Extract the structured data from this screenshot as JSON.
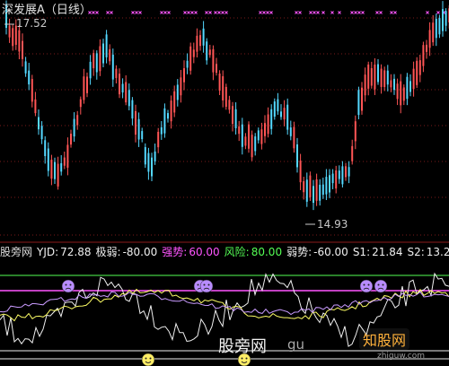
{
  "title": "深发展A（日线）",
  "price": {
    "high": "17.52",
    "low": "14.93"
  },
  "indicator": {
    "name": "股旁网",
    "yjd_label": "YJD:",
    "yjd_value": "72.88",
    "jiruo_label": "极弱:",
    "jiruo_value": "-80.00",
    "qiangshi_label": "强势:",
    "qiangshi_value": "60.00",
    "fengxian_label": "风险:",
    "fengxian_value": "80.00",
    "ruoshi_label": "弱势:",
    "ruoshi_value": "-60.00",
    "s1_label": "S1:",
    "s1_value": "21.84",
    "s2_label": "S2:",
    "s2_value": "13.20"
  },
  "colors": {
    "up": "#ff5555",
    "down": "#54d8ff",
    "grid": "#7a1a1a",
    "magenta": "#ff55ff",
    "green": "#55ff55",
    "white": "#f0f0f0",
    "yellow": "#ffff66",
    "purple": "#c99bff"
  },
  "watermark": {
    "site1": "股旁网",
    "site2": "gu",
    "brand": "知股网",
    "url": "zhiguw.com"
  }
}
